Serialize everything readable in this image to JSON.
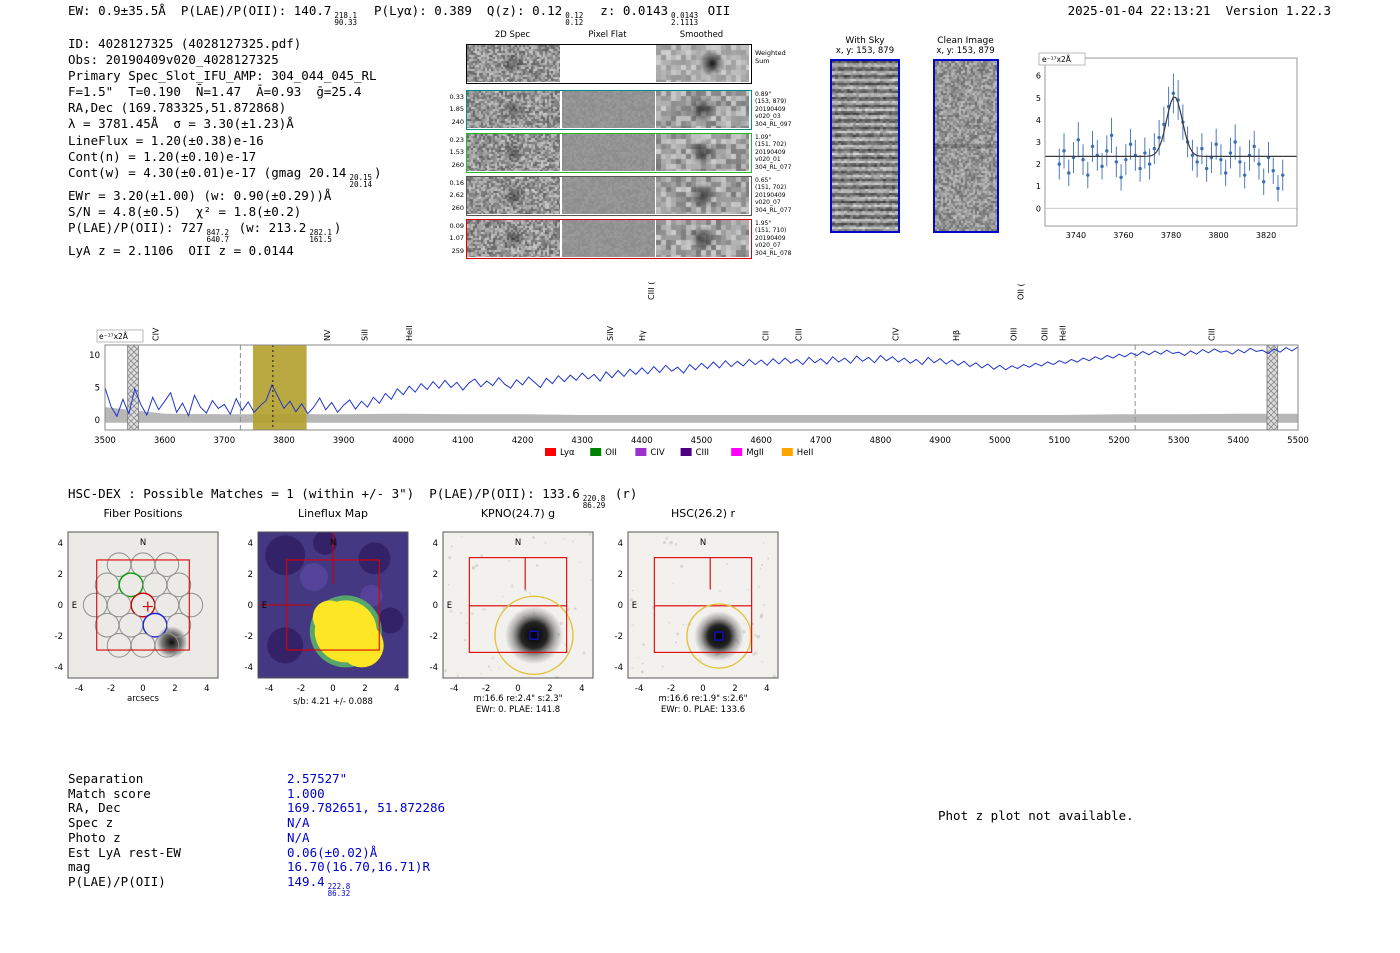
{
  "header": {
    "line": [
      {
        "t": "EW: 0.9±35.5Å  P(LAE)/P(OII): 140.7"
      },
      {
        "f": [
          "218.1",
          "90.33"
        ]
      },
      {
        "t": "  P(Lyα): 0.389  Q(z): 0.12"
      },
      {
        "f": [
          "0.12",
          "0.12"
        ]
      },
      {
        "t": "  z: 0.0143"
      },
      {
        "f": [
          "0.0143",
          "2.1113"
        ]
      },
      {
        "t": " OII"
      }
    ],
    "timestamp": "2025-01-04 22:13:21  Version 1.22.3"
  },
  "info_lines": [
    [
      {
        "t": "ID: 4028127325 (4028127325.pdf)"
      }
    ],
    [
      {
        "t": "Obs: 20190409v020_4028127325"
      }
    ],
    [
      {
        "t": "Primary Spec_Slot_IFU_AMP: 304_044_045_RL"
      }
    ],
    [
      {
        "t": "F=1.5\"  T=0.190  N̄=1.47  Ā=0.93  ḡ=25.4"
      }
    ],
    [
      {
        "t": "RA,Dec (169.783325,51.872868)"
      }
    ],
    [
      {
        "t": "λ = 3781.45Å  σ = 3.30(±1.23)Å"
      }
    ],
    [
      {
        "t": "LineFlux = 1.20(±0.38)e-16"
      }
    ],
    [
      {
        "t": "Cont(n) = 1.20(±0.10)e-17"
      }
    ],
    [
      {
        "t": "Cont(w) = 4.30(±0.01)e-17 (gmag 20.14"
      },
      {
        "f": [
          "20.15",
          "20.14"
        ]
      },
      {
        "t": ")"
      }
    ],
    [
      {
        "t": "EWr = 3.20(±1.00) (w: 0.90(±0.29))Å"
      }
    ],
    [
      {
        "t": "S/N = 4.8(±0.5)  χ² = 1.8(±0.2)"
      }
    ],
    [
      {
        "t": "P(LAE)/P(OII): 727"
      },
      {
        "f": [
          "847.2",
          "640.7"
        ]
      },
      {
        "t": " (w: 213.2"
      },
      {
        "f": [
          "282.1",
          "161.5"
        ]
      },
      {
        "t": ")"
      }
    ],
    [
      {
        "t": "LyA z = 2.1106  OII z = 0.0144"
      }
    ]
  ],
  "spec2d": {
    "col_titles": [
      "2D Spec",
      "Pixel Flat",
      "Smoothed"
    ],
    "rows": [
      {
        "right": [
          "Weighted",
          "Sum"
        ],
        "border": "#000000"
      },
      {
        "left": [
          "0.33",
          "1.85",
          "240"
        ],
        "right": [
          "0.89\"",
          "(153, 879)",
          "20190409",
          "v020_03",
          "304_RL_097"
        ],
        "border": "#008b8b"
      },
      {
        "left": [
          "0.23",
          "1.53",
          "260"
        ],
        "right": [
          "1.09\"",
          "(151, 702)",
          "20190409",
          "v020_01",
          "304_RL_077"
        ],
        "border": "#22bb22"
      },
      {
        "left": [
          "0.16",
          "2.62",
          "260"
        ],
        "right": [
          "0.65\"",
          "(151, 702)",
          "20190409",
          "v020_07",
          "304_RL_077"
        ],
        "border": "#555555"
      },
      {
        "left": [
          "0.09",
          "1.07",
          "259"
        ],
        "right": [
          "1.95\"",
          "(151, 710)",
          "20190409",
          "v020_07",
          "304_RL_078"
        ],
        "border": "#dd0000"
      }
    ]
  },
  "sky_panels": [
    {
      "title": "With Sky",
      "subtitle": "x, y: 153, 879"
    },
    {
      "title": "Clean Image",
      "subtitle": "x, y: 153, 879"
    }
  ],
  "hscdex": {
    "line": [
      {
        "t": "HSC-DEX : Possible Matches = 1 (within +/- 3\")  P(LAE)/P(OII): 133.6"
      },
      {
        "f": [
          "220.8",
          "86.29"
        ]
      },
      {
        "t": " (r)"
      }
    ]
  },
  "match_table": {
    "rows": [
      {
        "label": "Separation",
        "value": [
          {
            "t": "2.57527\""
          }
        ]
      },
      {
        "label": "Match score",
        "value": [
          {
            "t": "1.000"
          }
        ]
      },
      {
        "label": "RA, Dec",
        "value": [
          {
            "t": "169.782651, 51.872286"
          }
        ]
      },
      {
        "label": "Spec z",
        "value": [
          {
            "t": "N/A"
          }
        ]
      },
      {
        "label": "Photo z",
        "value": [
          {
            "t": "N/A"
          }
        ]
      },
      {
        "label": "Est LyA rest-EW",
        "value": [
          {
            "t": "0.06(±0.02)Å"
          }
        ]
      },
      {
        "label": "mag",
        "value": [
          {
            "t": "16.70(16.70,16.71)R"
          }
        ]
      },
      {
        "label": "P(LAE)/P(OII)",
        "value": [
          {
            "t": "149.4"
          },
          {
            "f": [
              "222.8",
              "86.32"
            ]
          }
        ]
      }
    ]
  },
  "notice": "Phot z plot not available.",
  "chart_data": [
    {
      "name": "detection_line_fit_zoom",
      "type": "scatter",
      "units_label": "e⁻¹⁷x2Å",
      "xlim": [
        3727,
        3833
      ],
      "ylim": [
        -0.8,
        6.8
      ],
      "xticks": [
        3740,
        3760,
        3780,
        3800,
        3820
      ],
      "yticks": [
        0,
        1,
        2,
        3,
        4,
        5,
        6
      ],
      "point_color": "#3b6cb5",
      "fit": {
        "mu": 3781.45,
        "sigma": 3.3,
        "baseline": 2.35,
        "peak": 5.05
      },
      "points": [
        [
          3733,
          2.0,
          0.7
        ],
        [
          3735,
          2.6,
          0.8
        ],
        [
          3737,
          1.6,
          0.6
        ],
        [
          3739,
          2.3,
          0.7
        ],
        [
          3741,
          3.1,
          0.8
        ],
        [
          3743,
          2.2,
          0.7
        ],
        [
          3745,
          1.5,
          0.6
        ],
        [
          3747,
          2.8,
          0.7
        ],
        [
          3749,
          2.4,
          0.7
        ],
        [
          3751,
          1.9,
          0.6
        ],
        [
          3753,
          2.6,
          0.7
        ],
        [
          3755,
          3.3,
          0.8
        ],
        [
          3757,
          2.1,
          0.7
        ],
        [
          3759,
          1.4,
          0.6
        ],
        [
          3761,
          2.2,
          0.7
        ],
        [
          3763,
          2.9,
          0.7
        ],
        [
          3765,
          2.4,
          0.7
        ],
        [
          3767,
          1.8,
          0.6
        ],
        [
          3769,
          2.5,
          0.7
        ],
        [
          3771,
          2.0,
          0.7
        ],
        [
          3773,
          2.7,
          0.7
        ],
        [
          3775,
          3.2,
          0.8
        ],
        [
          3777,
          3.8,
          0.8
        ],
        [
          3779,
          4.6,
          0.9
        ],
        [
          3781,
          5.2,
          0.9
        ],
        [
          3783,
          4.9,
          0.9
        ],
        [
          3785,
          3.9,
          0.8
        ],
        [
          3787,
          3.0,
          0.7
        ],
        [
          3789,
          2.4,
          0.7
        ],
        [
          3791,
          2.1,
          0.7
        ],
        [
          3793,
          2.7,
          0.7
        ],
        [
          3795,
          1.8,
          0.6
        ],
        [
          3797,
          2.3,
          0.7
        ],
        [
          3799,
          2.9,
          0.7
        ],
        [
          3801,
          2.2,
          0.7
        ],
        [
          3803,
          1.6,
          0.6
        ],
        [
          3805,
          2.5,
          0.7
        ],
        [
          3807,
          3.0,
          0.8
        ],
        [
          3809,
          2.1,
          0.7
        ],
        [
          3811,
          1.5,
          0.6
        ],
        [
          3813,
          2.4,
          0.7
        ],
        [
          3815,
          2.8,
          0.7
        ],
        [
          3817,
          2.0,
          0.7
        ],
        [
          3819,
          1.2,
          0.6
        ],
        [
          3821,
          2.3,
          0.7
        ],
        [
          3823,
          1.7,
          0.6
        ],
        [
          3825,
          0.9,
          0.6
        ],
        [
          3827,
          1.5,
          0.7
        ]
      ]
    },
    {
      "name": "full_spectrum",
      "type": "line",
      "units_label": "e⁻¹⁷x2Å",
      "xlim": [
        3500,
        5500
      ],
      "ylim": [
        -1.5,
        11.5
      ],
      "xtick_step": 100,
      "yticks": [
        0,
        5,
        10
      ],
      "line_color": "#2036cc",
      "x0": 3500,
      "dx": 10,
      "flux": [
        5.0,
        2.1,
        0.6,
        3.2,
        1.0,
        4.8,
        2.4,
        0.8,
        3.5,
        1.6,
        2.9,
        4.2,
        1.2,
        2.6,
        0.7,
        3.8,
        2.0,
        1.1,
        3.0,
        1.8,
        2.4,
        0.9,
        3.3,
        1.5,
        2.8,
        1.2,
        2.2,
        3.0,
        5.4,
        3.6,
        1.8,
        2.9,
        1.3,
        2.5,
        1.0,
        2.0,
        3.4,
        1.6,
        2.7,
        1.2,
        2.3,
        3.1,
        1.7,
        2.9,
        2.0,
        3.5,
        2.6,
        4.1,
        3.2,
        4.8,
        3.9,
        5.2,
        4.3,
        5.6,
        4.7,
        5.9,
        4.9,
        6.1,
        5.0,
        5.8,
        4.6,
        5.7,
        6.3,
        5.1,
        6.0,
        5.3,
        6.5,
        5.5,
        4.9,
        6.2,
        5.4,
        6.6,
        5.8,
        5.0,
        6.4,
        5.6,
        6.8,
        5.9,
        6.9,
        6.1,
        7.2,
        6.3,
        7.0,
        6.0,
        7.4,
        6.5,
        7.6,
        6.7,
        7.8,
        7.0,
        8.0,
        7.1,
        8.2,
        7.3,
        8.4,
        7.5,
        8.1,
        7.2,
        8.5,
        7.7,
        8.7,
        7.9,
        8.9,
        8.0,
        9.1,
        8.2,
        9.0,
        8.3,
        9.3,
        8.5,
        9.2,
        8.4,
        9.4,
        8.6,
        9.5,
        8.7,
        9.3,
        8.5,
        9.6,
        8.8,
        9.4,
        8.6,
        9.7,
        8.9,
        9.5,
        8.7,
        9.8,
        9.0,
        9.6,
        8.8,
        9.9,
        9.1,
        9.7,
        8.9,
        9.5,
        8.7,
        9.3,
        8.5,
        9.6,
        8.8,
        9.4,
        8.6,
        9.2,
        8.4,
        9.0,
        8.2,
        8.8,
        8.0,
        8.6,
        7.8,
        8.4,
        7.7,
        8.3,
        7.9,
        8.5,
        8.1,
        8.7,
        8.3,
        8.9,
        8.5,
        9.1,
        8.7,
        9.3,
        8.9,
        9.5,
        9.1,
        9.7,
        9.3,
        9.9,
        9.5,
        10.1,
        9.7,
        10.3,
        9.9,
        10.5,
        10.0,
        10.6,
        10.1,
        10.7,
        10.2,
        10.4,
        9.9,
        10.6,
        10.1,
        10.8,
        10.3,
        10.9,
        10.4,
        10.6,
        10.1,
        10.8,
        10.3,
        11.0,
        10.5,
        10.7,
        10.2,
        10.9,
        10.4,
        11.1,
        10.6,
        11.2
      ],
      "noise_top": {
        "x0": 3500,
        "dx": 100,
        "values": [
          2.0,
          1.0,
          0.9,
          0.9,
          0.9,
          1.0,
          0.9,
          0.9,
          0.8,
          0.8,
          0.8,
          0.8,
          0.8,
          0.8,
          0.8,
          0.8,
          0.8,
          0.9,
          0.9,
          1.0,
          1.0
        ]
      },
      "highlight_band": {
        "from": 3748,
        "to": 3838,
        "color": "#b3a02b"
      },
      "hatch_bands": [
        [
          3538,
          3556
        ],
        [
          5448,
          5466
        ]
      ],
      "dashed_lines": [
        3727,
        5227
      ],
      "dotted_line": 3781.45,
      "emission_labels": [
        {
          "text": "CIV",
          "wave": 3590,
          "color": "#e69f00"
        },
        {
          "text": "NV",
          "wave": 3877,
          "color": "#dd0000"
        },
        {
          "text": "SiII",
          "wave": 3940,
          "color": "#dd0000"
        },
        {
          "text": "HeII",
          "wave": 4015,
          "color": "#9932cc"
        },
        {
          "text": "SiIV",
          "wave": 4352,
          "color": "#dd0000"
        },
        {
          "text": "Hγ",
          "wave": 4405,
          "color": "#008000"
        },
        {
          "text": "CIII (",
          "wave": 4420,
          "color": "#e69f00",
          "high": true
        },
        {
          "text": "CII",
          "wave": 4612,
          "color": "#dd0000"
        },
        {
          "text": "CIII",
          "wave": 4668,
          "color": "#4b0082"
        },
        {
          "text": "CIV",
          "wave": 4830,
          "color": "#dd0000"
        },
        {
          "text": "Hβ",
          "wave": 4932,
          "color": "#008000"
        },
        {
          "text": "OIII",
          "wave": 5028,
          "color": "#008000"
        },
        {
          "text": "OII (",
          "wave": 5040,
          "color": "#ff00ff",
          "high": true
        },
        {
          "text": "OIII",
          "wave": 5080,
          "color": "#008000"
        },
        {
          "text": "HeII",
          "wave": 5110,
          "color": "#dd0000"
        },
        {
          "text": "CIII",
          "wave": 5360,
          "color": "#e69f00"
        }
      ],
      "legend": [
        {
          "label": "Lyα",
          "color": "#ff0000"
        },
        {
          "label": "OII",
          "color": "#008000"
        },
        {
          "label": "CIV",
          "color": "#9932cc"
        },
        {
          "label": "CIII",
          "color": "#4b0082"
        },
        {
          "label": "MgII",
          "color": "#ff00ff"
        },
        {
          "label": "HeII",
          "color": "#ffa500"
        }
      ]
    },
    {
      "name": "cutouts",
      "type": "heatmap",
      "ticks": [
        -4,
        -2,
        0,
        2,
        4
      ],
      "panels": [
        {
          "title": "Fiber Positions",
          "xlabel": "arcsecs",
          "style": "fiber"
        },
        {
          "title": "Lineflux Map",
          "style": "flux",
          "captions": [
            "s/b: 4.21 +/- 0.088"
          ]
        },
        {
          "title": "KPNO(24.7) g",
          "style": "img",
          "captions": [
            "m:16.6 re:2.4\" s:2.3\"",
            "EWr: 0. PLAE: 141.8"
          ]
        },
        {
          "title": "HSC(26.2) r",
          "style": "img",
          "captions": [
            "m:16.6 re:1.9\" s:2.6\"",
            "EWr: 0. PLAE: 133.6"
          ]
        }
      ]
    }
  ]
}
